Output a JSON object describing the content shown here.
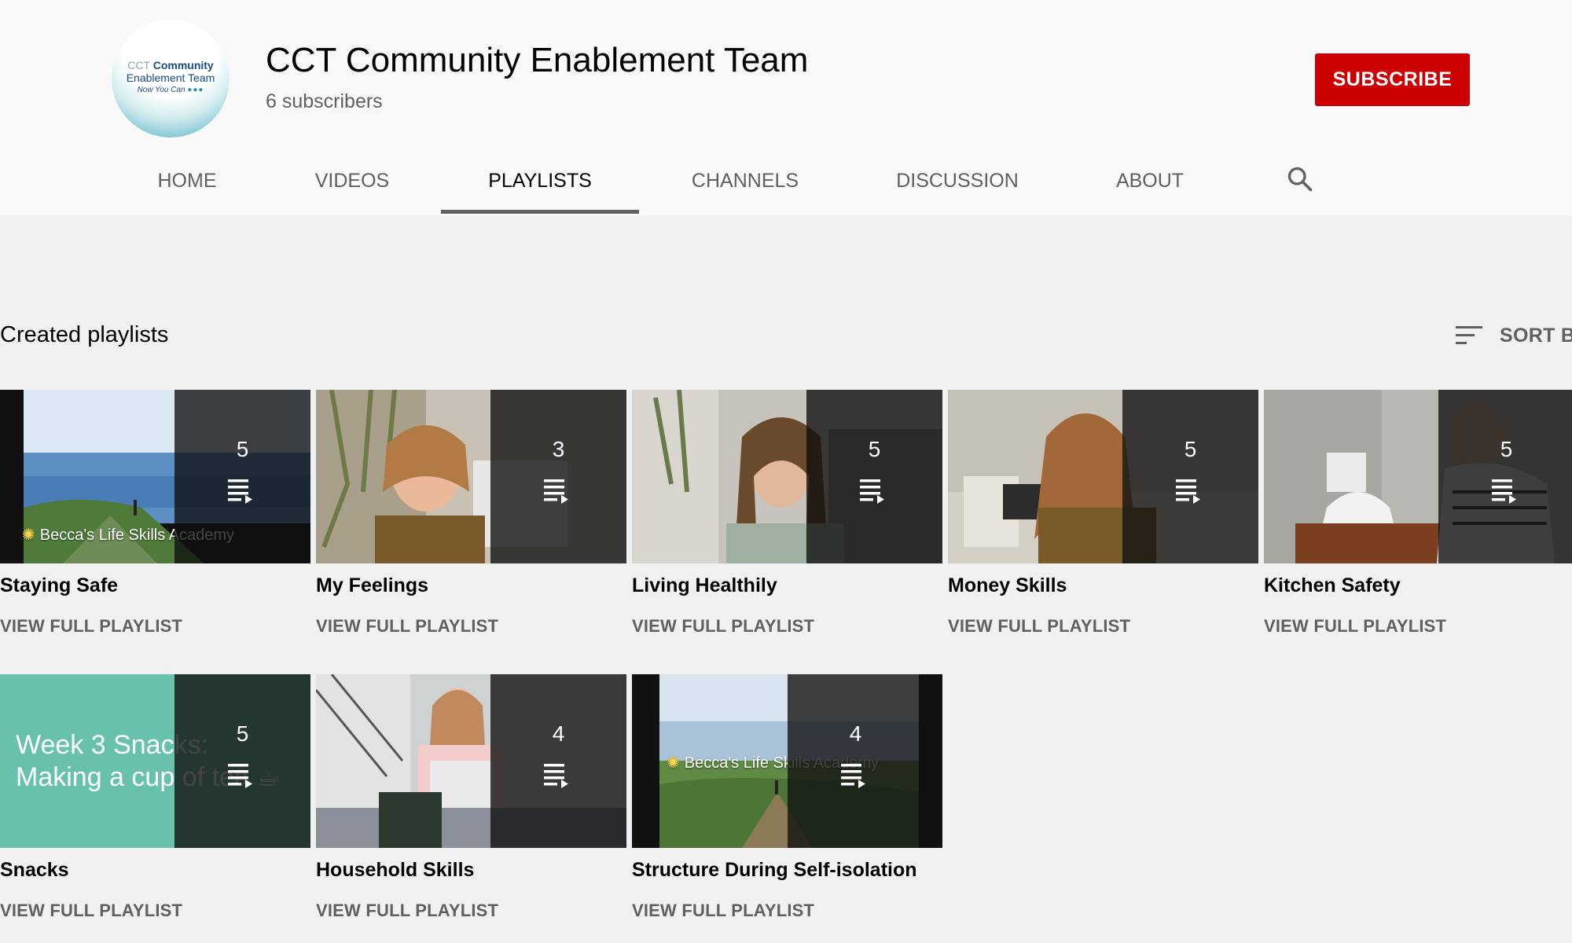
{
  "channel": {
    "avatar": {
      "line1_prefix": "CCT",
      "line1_bold": "Community",
      "line2": "Enablement Team",
      "line3": "Now You Can",
      "line3_dots": "●●●"
    },
    "name": "CCT Community Enablement Team",
    "subscribers": "6 subscribers",
    "subscribe_label": "SUBSCRIBE"
  },
  "tabs": [
    {
      "label": "HOME"
    },
    {
      "label": "VIDEOS"
    },
    {
      "label": "PLAYLISTS",
      "active": true
    },
    {
      "label": "CHANNELS"
    },
    {
      "label": "DISCUSSION"
    },
    {
      "label": "ABOUT"
    }
  ],
  "section": {
    "title": "Created playlists",
    "sort_label": "SORT BY"
  },
  "playlists": [
    {
      "title": "Staying Safe",
      "count": "5",
      "link": "VIEW FULL PLAYLIST",
      "caption": "Becca's Life Skills Academy"
    },
    {
      "title": "My Feelings",
      "count": "3",
      "link": "VIEW FULL PLAYLIST"
    },
    {
      "title": "Living Healthily",
      "count": "5",
      "link": "VIEW FULL PLAYLIST"
    },
    {
      "title": "Money Skills",
      "count": "5",
      "link": "VIEW FULL PLAYLIST"
    },
    {
      "title": "Kitchen Safety",
      "count": "5",
      "link": "VIEW FULL PLAYLIST"
    },
    {
      "title": "Snacks",
      "count": "5",
      "link": "VIEW FULL PLAYLIST",
      "caption_line1": "Week 3 Snacks:",
      "caption_line2": "Making a cup of tea ☕"
    },
    {
      "title": "Household Skills",
      "count": "4",
      "link": "VIEW FULL PLAYLIST"
    },
    {
      "title": "Structure During Self-isolation",
      "count": "4",
      "link": "VIEW FULL PLAYLIST",
      "caption": "Becca's Life Skills Academy"
    }
  ],
  "colors": {
    "subscribe": "#cc0000",
    "header_bg": "#f9f9f9",
    "page_bg": "#f1f1f1",
    "snack_teal": "#68c1ac"
  },
  "icons": [
    "search-icon",
    "sort-icon",
    "playlist-icon"
  ]
}
